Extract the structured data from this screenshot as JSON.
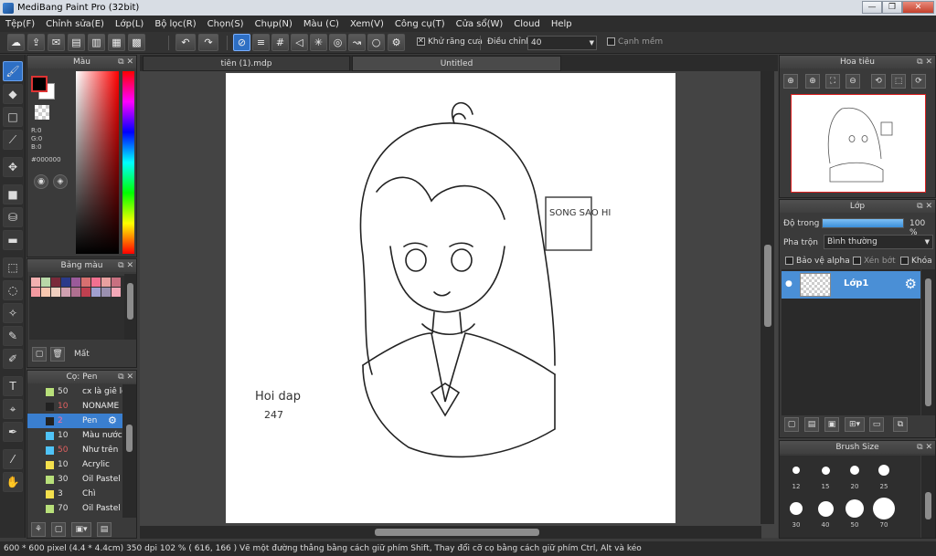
{
  "window": {
    "title": "MediBang Paint Pro (32bit)",
    "min": "—",
    "max": "❐",
    "close": "✕"
  },
  "menu": [
    "Tệp(F)",
    "Chỉnh sửa(E)",
    "Lớp(L)",
    "Bộ lọc(R)",
    "Chọn(S)",
    "Chụp(N)",
    "Màu (C)",
    "Xem(V)",
    "Công cụ(T)",
    "Cửa sổ(W)",
    "Cloud",
    "Help"
  ],
  "toolbar": {
    "antialias_label": "Khử răng cưa",
    "adjust_label": "Điều chỉnh",
    "adjust_value": "40",
    "soft_edge_label": "Cạnh mềm"
  },
  "color_panel": {
    "title": "Màu",
    "r": "R:0",
    "g": "G:0",
    "b": "B:0",
    "hex": "#000000",
    "colors": {
      "hue_red": "#ff0000",
      "fg": "#000000",
      "bg": "#ffffff"
    }
  },
  "palette_panel": {
    "title": "Bảng màu",
    "delete_label": "Mất",
    "swatches": [
      "#f2b0b0",
      "#b8d8a8",
      "#7a2a3a",
      "#2a3a8a",
      "#9a5a9a",
      "#d87070",
      "#f27090",
      "#e8a0a0",
      "#c87080",
      "#f49aa0",
      "#f8c8b0",
      "#f0d0c0",
      "#d0a0b0",
      "#b07090",
      "#c04050",
      "#a0a0d0",
      "#9a90b0",
      "#f4a8b8"
    ]
  },
  "brush_panel": {
    "title": "Cọ: Pen",
    "brushes": [
      {
        "size": "50",
        "name": "cx là giê lo",
        "color": "#b8e07a"
      },
      {
        "size": "10",
        "name": "NONAME",
        "color": "#222222"
      },
      {
        "size": "2",
        "name": "Pen",
        "color": "#222222"
      },
      {
        "size": "10",
        "name": "Màu nước",
        "color": "#4fc3f7"
      },
      {
        "size": "50",
        "name": "Như trên",
        "color": "#4fc3f7"
      },
      {
        "size": "10",
        "name": "Acrylic",
        "color": "#f4e04d"
      },
      {
        "size": "30",
        "name": "Oil Pastel",
        "color": "#b8e07a"
      },
      {
        "size": "3",
        "name": "Chì",
        "color": "#f4e04d"
      },
      {
        "size": "70",
        "name": "Oil Pastel",
        "color": "#b8e07a"
      }
    ]
  },
  "tabs": [
    "tiên (1).mdp",
    "Untitled"
  ],
  "canvas": {
    "sign_text": "SONG SAO HI",
    "watermark_line1": "Hoi dap",
    "watermark_line2": "247"
  },
  "navigator": {
    "title": "Hoa tiêu"
  },
  "layer_panel": {
    "title": "Lớp",
    "opacity_label": "Độ trong",
    "opacity_value": "100 %",
    "opacity_fraction": 1.0,
    "blend_label": "Pha trộn",
    "blend_value": "Bình thường",
    "protect_alpha": "Bảo vệ alpha",
    "clip": "Xén bớt",
    "lock": "Khóa",
    "layer_name": "Lớp1"
  },
  "brush_size_panel": {
    "title": "Brush Size",
    "sizes": [
      "12",
      "15",
      "20",
      "25",
      "30",
      "40",
      "50",
      "70"
    ]
  },
  "status": {
    "text": "600 * 600 pixel   (4.4 * 4.4cm)   350 dpi   102 %   ( 616, 166 )   Vẽ một đường thẳng bằng cách giữ phím Shift, Thay đổi cỡ cọ bằng cách giữ phím Ctrl, Alt và kéo"
  }
}
